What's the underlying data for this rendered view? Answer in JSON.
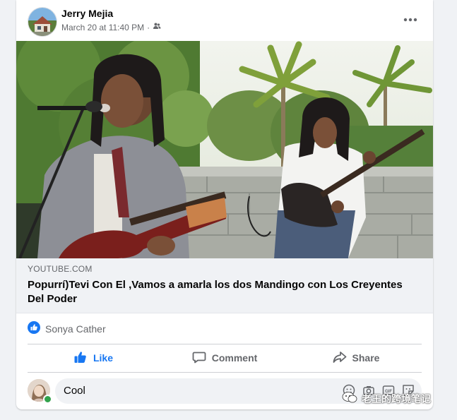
{
  "post": {
    "author": "Jerry Mejia",
    "timestamp": "March 20 at 11:40 PM",
    "separator": "·",
    "audience_icon": "friends-icon",
    "more_icon": "more-horizontal-icon"
  },
  "link": {
    "domain": "YOUTUBE.COM",
    "title": "Popurrí)Tevi Con El ,Vamos a amarla los dos Mandingo con Los Creyentes Del Poder"
  },
  "reactions": {
    "icon": "like-reaction-icon",
    "names": "Sonya Cather"
  },
  "actions": {
    "like": "Like",
    "comment": "Comment",
    "share": "Share"
  },
  "comment_box": {
    "value": "Cool",
    "tool_icons": [
      "emoji-icon",
      "camera-icon",
      "gif-icon",
      "sticker-icon"
    ]
  },
  "watermark": {
    "text": "老王的跨境笔记"
  },
  "colors": {
    "accent": "#1877f2",
    "text_primary": "#050505",
    "text_secondary": "#65676b",
    "background": "#f0f2f5",
    "online": "#31a24c"
  }
}
